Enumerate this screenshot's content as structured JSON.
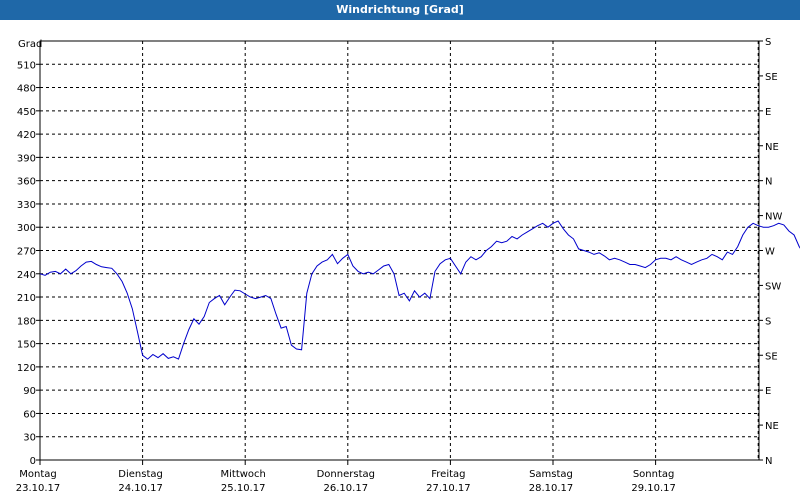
{
  "window": {
    "title": "Windrichtung [Grad]"
  },
  "chart_data": {
    "type": "line",
    "title": "Windrichtung [Grad]",
    "ylabel": "Grad",
    "ylim": [
      0,
      540
    ],
    "yticks": [
      0,
      30,
      60,
      90,
      120,
      150,
      180,
      210,
      240,
      270,
      300,
      330,
      360,
      390,
      420,
      450,
      480,
      510
    ],
    "right_axis_labels": [
      "N",
      "NE",
      "E",
      "SE",
      "S",
      "SW",
      "W",
      "NW",
      "N",
      "NE",
      "E",
      "SE",
      "S"
    ],
    "xlim": [
      0,
      7
    ],
    "x_unit": "days",
    "x_day_labels": [
      {
        "weekday": "Montag",
        "date": "23.10.17"
      },
      {
        "weekday": "Dienstag",
        "date": "24.10.17"
      },
      {
        "weekday": "Mittwoch",
        "date": "25.10.17"
      },
      {
        "weekday": "Donnerstag",
        "date": "26.10.17"
      },
      {
        "weekday": "Freitag",
        "date": "27.10.17"
      },
      {
        "weekday": "Samstag",
        "date": "28.10.17"
      },
      {
        "weekday": "Sonntag",
        "date": "29.10.17"
      }
    ],
    "grid": true,
    "line_color": "#0000cc",
    "series": [
      {
        "name": "",
        "points": [
          [
            0.0,
            240
          ],
          [
            0.05,
            238
          ],
          [
            0.1,
            242
          ],
          [
            0.15,
            243
          ],
          [
            0.2,
            240
          ],
          [
            0.25,
            246
          ],
          [
            0.3,
            240
          ],
          [
            0.35,
            244
          ],
          [
            0.4,
            250
          ],
          [
            0.45,
            255
          ],
          [
            0.5,
            256
          ],
          [
            0.55,
            252
          ],
          [
            0.6,
            249
          ],
          [
            0.65,
            248
          ],
          [
            0.7,
            247
          ],
          [
            0.75,
            240
          ],
          [
            0.8,
            230
          ],
          [
            0.85,
            215
          ],
          [
            0.9,
            195
          ],
          [
            0.95,
            165
          ],
          [
            1.0,
            135
          ],
          [
            1.05,
            130
          ],
          [
            1.1,
            136
          ],
          [
            1.15,
            132
          ],
          [
            1.2,
            137
          ],
          [
            1.25,
            131
          ],
          [
            1.3,
            133
          ],
          [
            1.35,
            130
          ],
          [
            1.4,
            150
          ],
          [
            1.45,
            168
          ],
          [
            1.5,
            182
          ],
          [
            1.55,
            175
          ],
          [
            1.6,
            185
          ],
          [
            1.65,
            203
          ],
          [
            1.7,
            208
          ],
          [
            1.75,
            212
          ],
          [
            1.8,
            200
          ],
          [
            1.85,
            210
          ],
          [
            1.9,
            219
          ],
          [
            1.95,
            218
          ],
          [
            2.0,
            214
          ],
          [
            2.05,
            210
          ],
          [
            2.1,
            208
          ],
          [
            2.15,
            210
          ],
          [
            2.2,
            212
          ],
          [
            2.25,
            208
          ],
          [
            2.3,
            188
          ],
          [
            2.35,
            170
          ],
          [
            2.4,
            172
          ],
          [
            2.45,
            148
          ],
          [
            2.5,
            143
          ],
          [
            2.55,
            142
          ],
          [
            2.6,
            215
          ],
          [
            2.65,
            240
          ],
          [
            2.7,
            250
          ],
          [
            2.75,
            255
          ],
          [
            2.8,
            258
          ],
          [
            2.85,
            265
          ],
          [
            2.9,
            253
          ],
          [
            2.95,
            260
          ],
          [
            3.0,
            265
          ],
          [
            3.05,
            250
          ],
          [
            3.1,
            243
          ],
          [
            3.15,
            240
          ],
          [
            3.2,
            242
          ],
          [
            3.25,
            240
          ],
          [
            3.3,
            245
          ],
          [
            3.35,
            250
          ],
          [
            3.4,
            252
          ],
          [
            3.45,
            240
          ],
          [
            3.5,
            212
          ],
          [
            3.55,
            215
          ],
          [
            3.6,
            205
          ],
          [
            3.65,
            218
          ],
          [
            3.7,
            210
          ],
          [
            3.75,
            215
          ],
          [
            3.8,
            208
          ],
          [
            3.85,
            243
          ],
          [
            3.9,
            253
          ],
          [
            3.95,
            258
          ],
          [
            4.0,
            260
          ],
          [
            4.05,
            250
          ],
          [
            4.1,
            240
          ],
          [
            4.15,
            255
          ],
          [
            4.2,
            262
          ],
          [
            4.25,
            258
          ],
          [
            4.3,
            262
          ],
          [
            4.35,
            270
          ],
          [
            4.4,
            275
          ],
          [
            4.45,
            282
          ],
          [
            4.5,
            280
          ],
          [
            4.55,
            282
          ],
          [
            4.6,
            288
          ],
          [
            4.65,
            285
          ],
          [
            4.7,
            290
          ],
          [
            4.75,
            294
          ],
          [
            4.8,
            298
          ],
          [
            4.85,
            302
          ],
          [
            4.9,
            305
          ],
          [
            4.95,
            300
          ],
          [
            5.0,
            305
          ],
          [
            5.05,
            308
          ],
          [
            5.1,
            298
          ],
          [
            5.15,
            290
          ],
          [
            5.2,
            285
          ],
          [
            5.25,
            272
          ],
          [
            5.3,
            270
          ],
          [
            5.35,
            268
          ],
          [
            5.4,
            265
          ],
          [
            5.45,
            267
          ],
          [
            5.5,
            263
          ],
          [
            5.55,
            258
          ],
          [
            5.6,
            260
          ],
          [
            5.65,
            258
          ],
          [
            5.7,
            255
          ],
          [
            5.75,
            252
          ],
          [
            5.8,
            252
          ],
          [
            5.85,
            250
          ],
          [
            5.9,
            248
          ],
          [
            5.95,
            252
          ],
          [
            6.0,
            258
          ],
          [
            6.05,
            260
          ],
          [
            6.1,
            260
          ],
          [
            6.15,
            258
          ],
          [
            6.2,
            262
          ],
          [
            6.25,
            258
          ],
          [
            6.3,
            255
          ],
          [
            6.35,
            252
          ],
          [
            6.4,
            255
          ],
          [
            6.45,
            258
          ],
          [
            6.5,
            260
          ],
          [
            6.55,
            265
          ],
          [
            6.6,
            262
          ],
          [
            6.65,
            258
          ],
          [
            6.7,
            268
          ],
          [
            6.75,
            265
          ],
          [
            6.8,
            275
          ],
          [
            6.85,
            290
          ],
          [
            6.9,
            300
          ],
          [
            6.95,
            305
          ],
          [
            7.0,
            302
          ],
          [
            7.05,
            300
          ],
          [
            7.1,
            300
          ],
          [
            7.15,
            302
          ],
          [
            7.2,
            305
          ],
          [
            7.25,
            303
          ],
          [
            7.3,
            295
          ],
          [
            7.35,
            290
          ],
          [
            7.4,
            275
          ],
          [
            7.45,
            265
          ],
          [
            7.5,
            268
          ],
          [
            7.55,
            272
          ],
          [
            7.6,
            268
          ]
        ]
      }
    ]
  }
}
